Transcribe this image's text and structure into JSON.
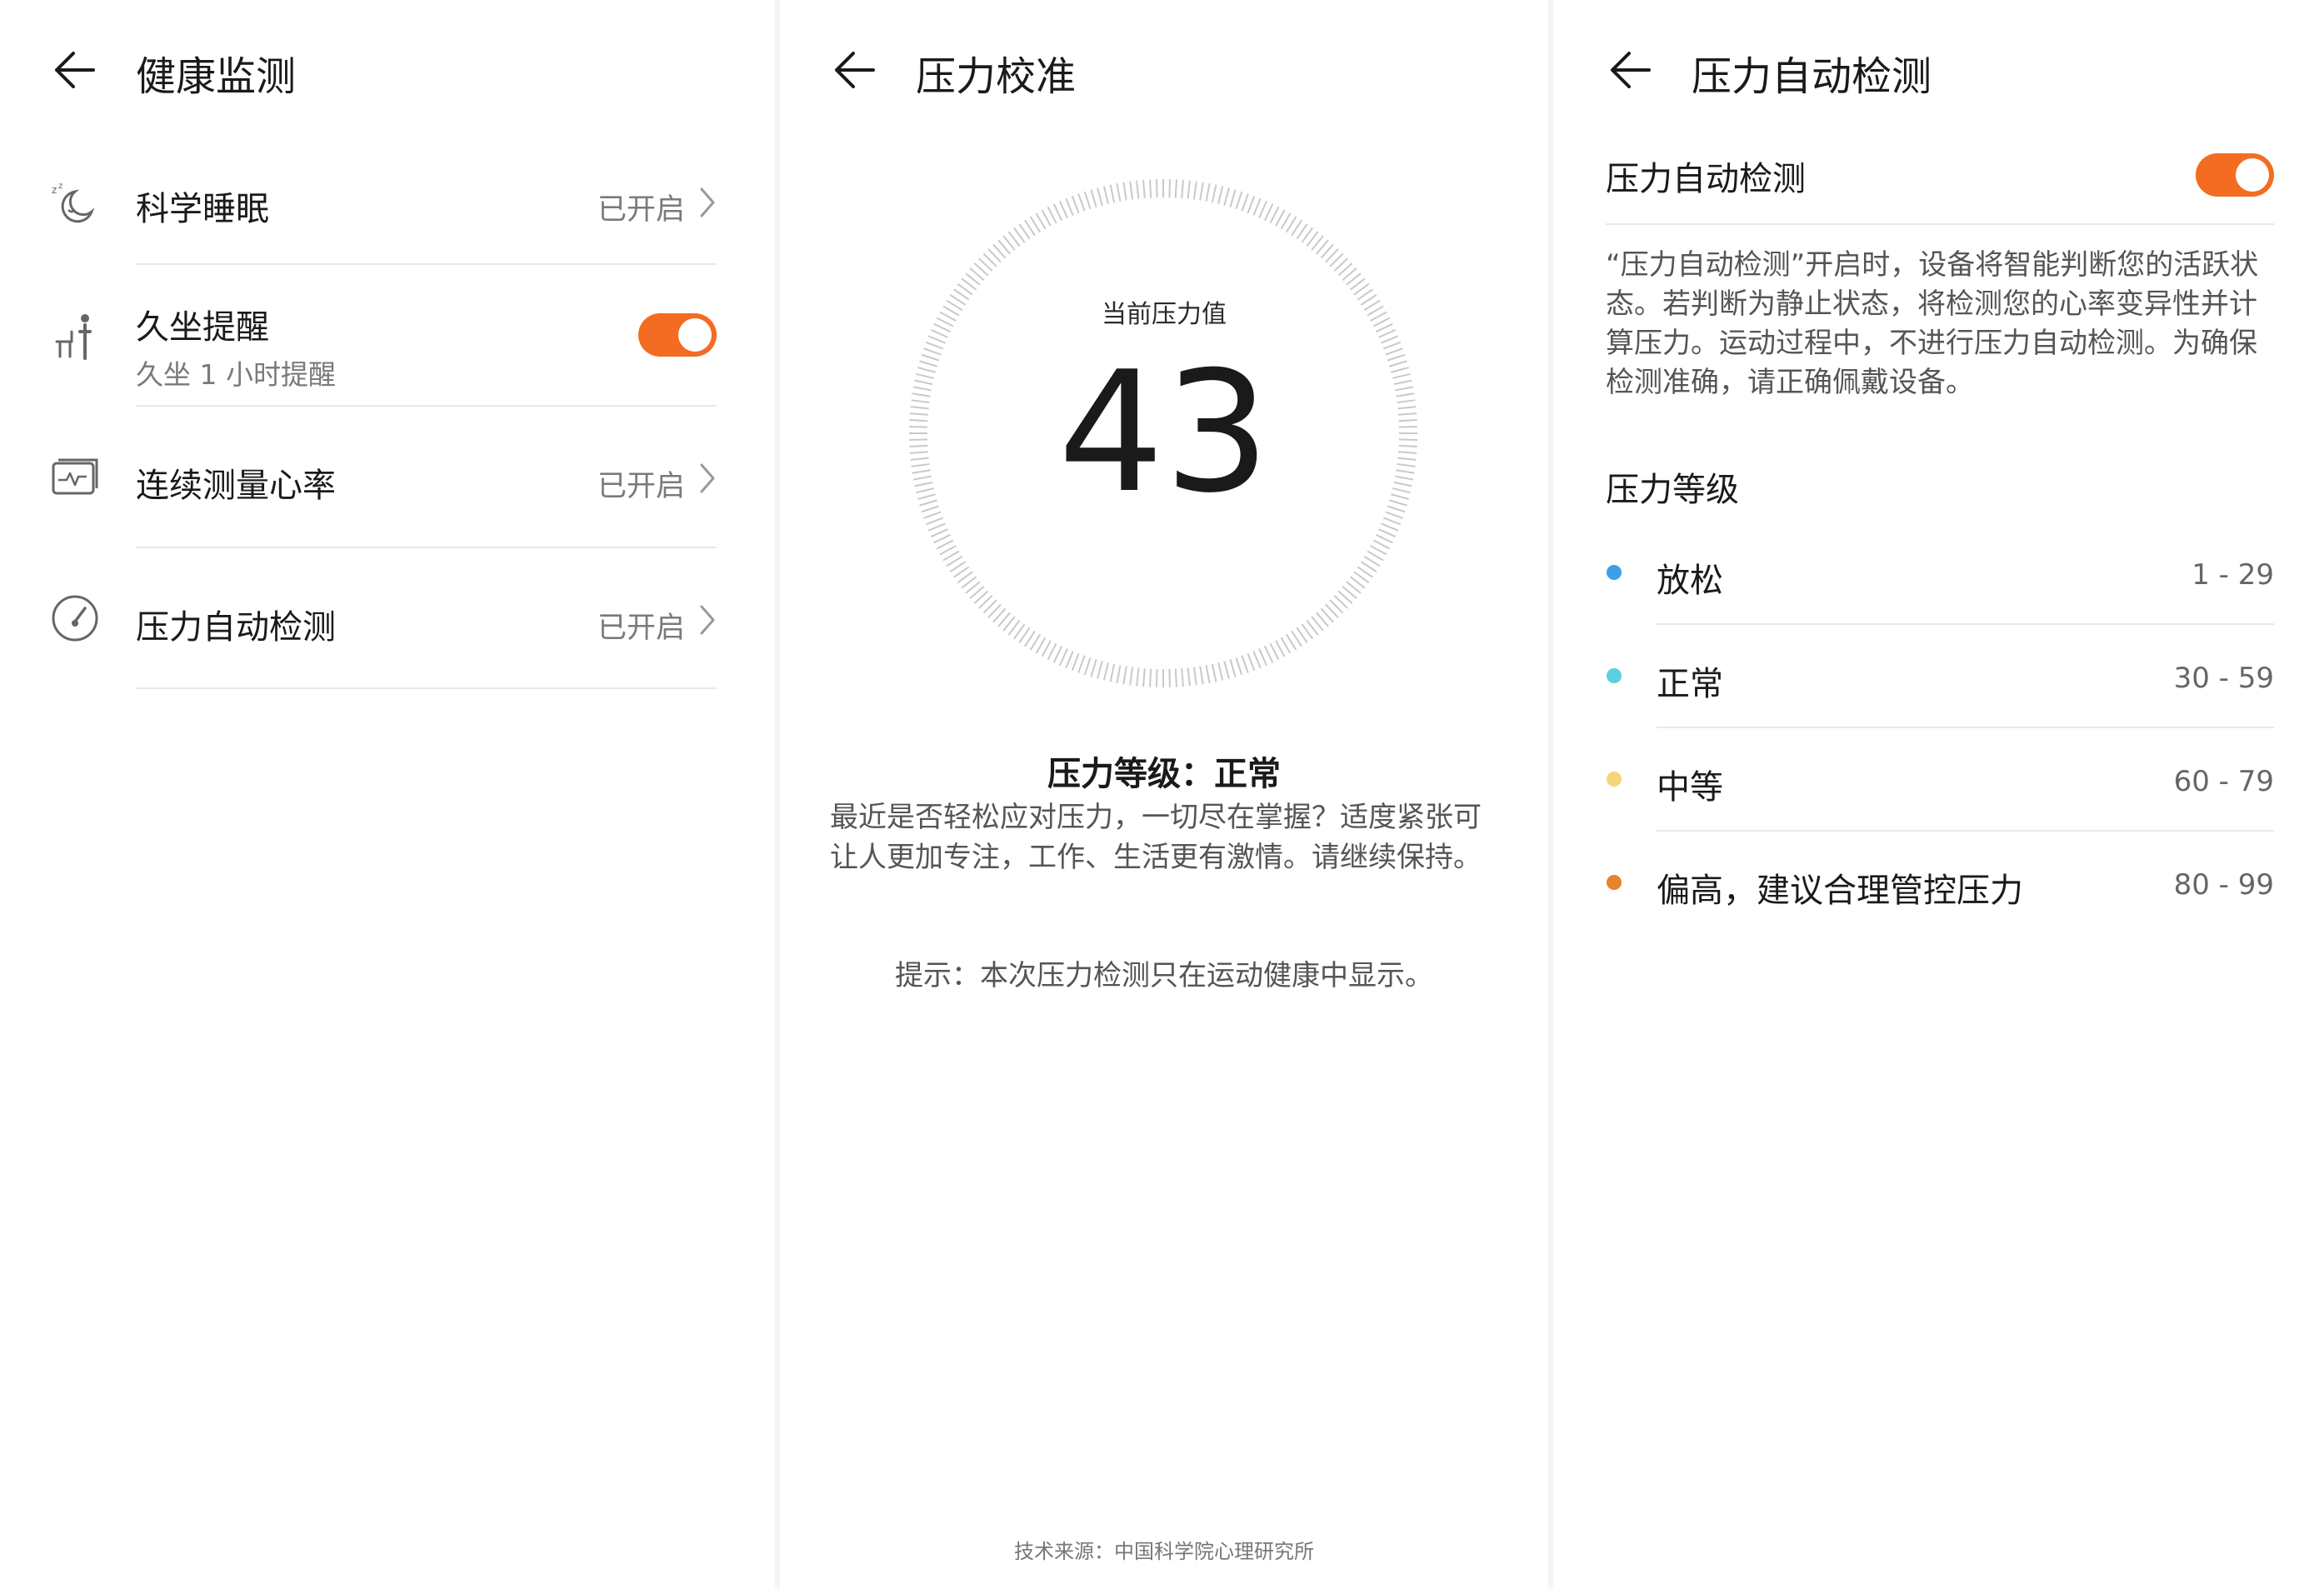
{
  "screen1": {
    "title": "健康监测",
    "items": [
      {
        "label": "科学睡眠",
        "icon": "sleep-icon",
        "status": "已开启"
      },
      {
        "label": "久坐提醒",
        "icon": "sedentary-icon",
        "sub": "久坐 1 小时提醒",
        "toggle_on": true
      },
      {
        "label": "连续测量心率",
        "icon": "heart-rate-icon",
        "status": "已开启"
      },
      {
        "label": "压力自动检测",
        "icon": "stress-gauge-icon",
        "status": "已开启"
      }
    ]
  },
  "screen2": {
    "title": "压力校准",
    "gauge_label": "当前压力值",
    "stress_value": "43",
    "level_line": "压力等级：正常",
    "level_desc": "最近是否轻松应对压力，一切尽在掌握？适度紧张可让人更加专注，工作、生活更有激情。请继续保持。",
    "tip": "提示：本次压力检测只在运动健康中显示。",
    "source": "技术来源：中国科学院心理研究所"
  },
  "screen3": {
    "title": "压力自动检测",
    "toggle_label": "压力自动检测",
    "toggle_on": true,
    "description": "“压力自动检测”开启时，设备将智能判断您的活跃状态。若判断为静止状态，将检测您的心率变异性并计算压力。运动过程中，不进行压力自动检测。为确保检测准确，请正确佩戴设备。",
    "section_title": "压力等级",
    "levels": [
      {
        "name": "放松",
        "range": "1 - 29",
        "color": "#3aa0e8"
      },
      {
        "name": "正常",
        "range": "30 - 59",
        "color": "#5ccfe0"
      },
      {
        "name": "中等",
        "range": "60 - 79",
        "color": "#f5d77a"
      },
      {
        "name": "偏高，建议合理管控压力",
        "range": "80 - 99",
        "color": "#e9822b"
      }
    ]
  },
  "colors": {
    "accent": "#f36c21",
    "text_secondary": "#7a7a7a",
    "divider": "#e8e8e8"
  }
}
